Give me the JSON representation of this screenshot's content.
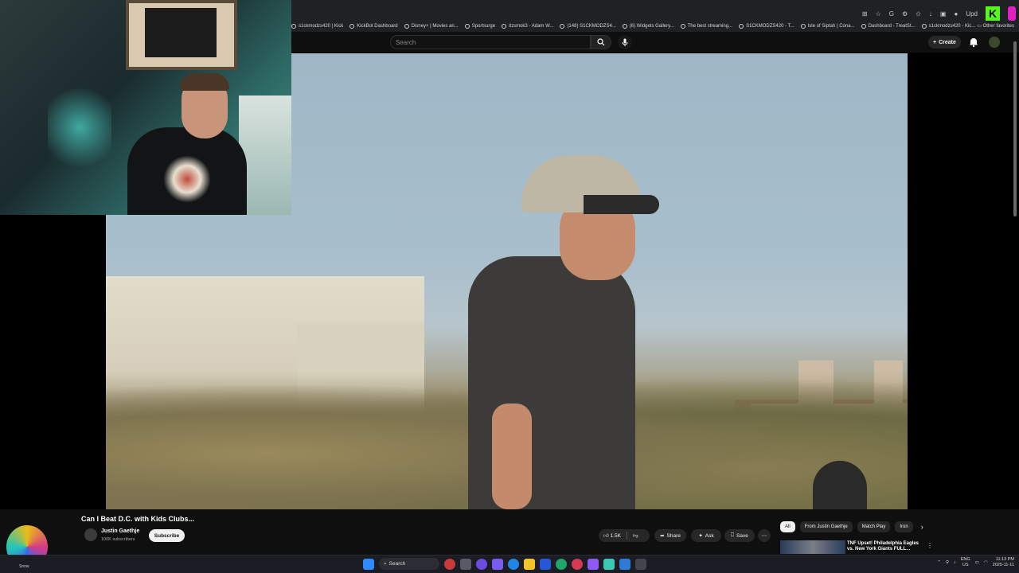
{
  "bookmarks": [
    {
      "label": "s1ckmodzs420 | Kick"
    },
    {
      "label": "KickBot Dashboard"
    },
    {
      "label": "Disney+ | Movies an..."
    },
    {
      "label": "Sportsurge"
    },
    {
      "label": "itzsmok3 - Adam W..."
    },
    {
      "label": "(148) S1CKMODZS4..."
    },
    {
      "label": "(6) Widgets Gallery..."
    },
    {
      "label": "The best streaming..."
    },
    {
      "label": "S1CKMODZS420 - T..."
    },
    {
      "label": "Isle of Siptah | Cona..."
    },
    {
      "label": "Dashboard - TreatSt..."
    },
    {
      "label": "s1ckmodzs420 - Kic..."
    }
  ],
  "browser": {
    "other_favorites": "Other favorites",
    "upgrade_label": "Upd"
  },
  "header": {
    "search_placeholder": "Search",
    "create_label": "Create"
  },
  "video": {
    "title": "Can I Beat D.C. with Kids Clubs...",
    "channel_name": "Justin Gaethje",
    "subscribers": "100K subscribers",
    "subscribe_label": "Subscribe",
    "likes": "1.5K",
    "share_label": "Share",
    "ask_label": "Ask",
    "save_label": "Save"
  },
  "chips": [
    {
      "label": "All"
    },
    {
      "label": "From Justin Gaethje"
    },
    {
      "label": "Match Play"
    },
    {
      "label": "Iron"
    }
  ],
  "recommendation": {
    "title": "TNF Upset! Philadelphia Eagles vs. New York Giants FULL..."
  },
  "taskbar": {
    "search_label": "Search",
    "snow_label": "Snow",
    "lang_line1": "ENG",
    "lang_line2": "US",
    "time": "11:13 PM",
    "date": "2025-11-11"
  },
  "colors": {
    "kick_green": "#53fc18",
    "yt_bg": "#0f0f0f"
  }
}
